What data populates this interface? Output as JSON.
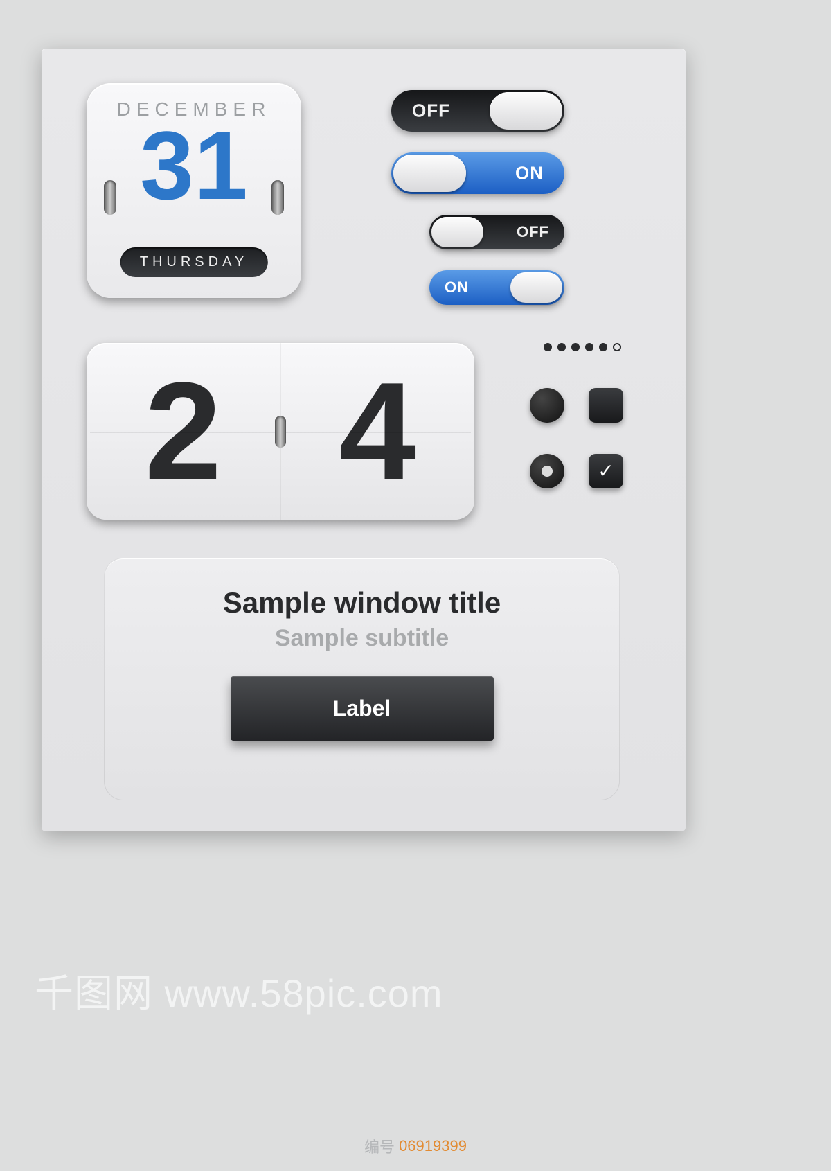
{
  "calendar": {
    "month": "DECEMBER",
    "day": "31",
    "weekday": "THURSDAY"
  },
  "toggles": {
    "t1": "OFF",
    "t2": "ON",
    "t3": "OFF",
    "t4": "ON"
  },
  "counter": {
    "d1": "2",
    "d2": "4"
  },
  "pager": {
    "total": 6,
    "active": 5
  },
  "window": {
    "title": "Sample window title",
    "subtitle": "Sample subtitle",
    "button": "Label"
  },
  "watermark": "千图网 www.58pic.com",
  "asset": {
    "label": "编号",
    "id": "06919399"
  },
  "colors": {
    "accent": "#2d77c9",
    "toggle_on": "#1c5fc4"
  }
}
